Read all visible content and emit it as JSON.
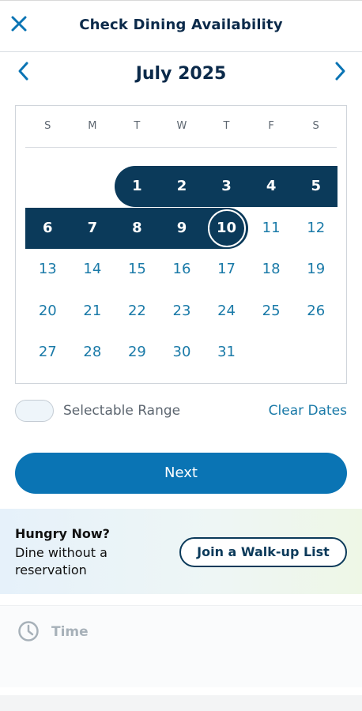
{
  "header": {
    "title": "Check Dining Availability",
    "close_icon": "close-icon"
  },
  "calendar": {
    "month_label": "July 2025",
    "prev_icon": "chevron-left-icon",
    "next_icon": "chevron-right-icon",
    "weekdays": [
      "S",
      "M",
      "T",
      "W",
      "T",
      "F",
      "S"
    ],
    "days": [
      "1",
      "2",
      "3",
      "4",
      "5",
      "6",
      "7",
      "8",
      "9",
      "10",
      "11",
      "12",
      "13",
      "14",
      "15",
      "16",
      "17",
      "18",
      "19",
      "20",
      "21",
      "22",
      "23",
      "24",
      "25",
      "26",
      "27",
      "28",
      "29",
      "30",
      "31"
    ],
    "selected_range": {
      "start": "1",
      "end": "10"
    },
    "today": "10",
    "colors": {
      "range": "#0b3a5a",
      "day_text": "#1a7aa8"
    }
  },
  "legend": {
    "label": "Selectable Range",
    "clear_label": "Clear Dates"
  },
  "actions": {
    "next_label": "Next",
    "next_color": "#0a74b4"
  },
  "walkup": {
    "heading": "Hungry Now?",
    "text": "Dine without a reservation",
    "button_label": "Join a Walk-up List"
  },
  "time": {
    "label": "Time",
    "icon": "clock-icon"
  }
}
